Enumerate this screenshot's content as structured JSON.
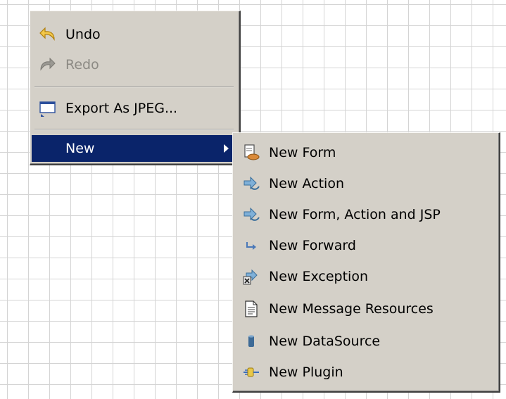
{
  "context_menu": {
    "items": [
      {
        "label": "Undo",
        "icon": "undo-icon",
        "enabled": true
      },
      {
        "label": "Redo",
        "icon": "redo-icon",
        "enabled": false
      },
      {
        "label": "Export As JPEG...",
        "icon": "export-image-icon",
        "enabled": true
      },
      {
        "label": "New",
        "icon": "",
        "enabled": true,
        "selected": true,
        "has_submenu": true
      }
    ]
  },
  "submenu": {
    "items": [
      {
        "label": "New Form",
        "icon": "form-icon"
      },
      {
        "label": "New Action",
        "icon": "action-icon"
      },
      {
        "label": "New Form, Action and JSP",
        "icon": "form-action-jsp-icon"
      },
      {
        "label": "New Forward",
        "icon": "forward-arrow-icon"
      },
      {
        "label": "New Exception",
        "icon": "exception-icon"
      },
      {
        "label": "New Message Resources",
        "icon": "document-icon"
      },
      {
        "label": "New DataSource",
        "icon": "datasource-icon"
      },
      {
        "label": "New Plugin",
        "icon": "plugin-icon"
      }
    ]
  },
  "colors": {
    "menu_background": "#d4d0c8",
    "selection": "#0a246a",
    "disabled_text": "#8c8a84",
    "grid_line": "#d4d4d4"
  }
}
